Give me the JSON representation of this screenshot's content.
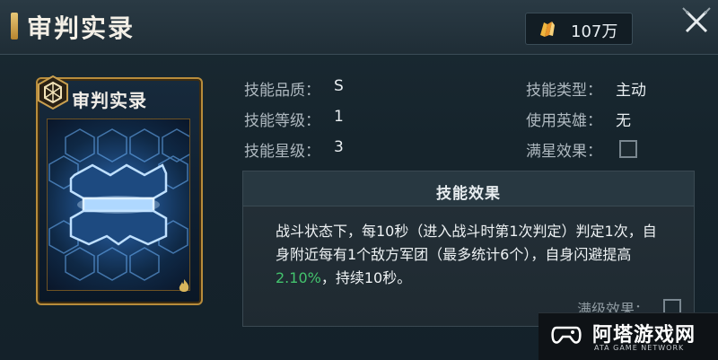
{
  "header": {
    "title": "审判实录",
    "currency_icon": "gold-crystal-icon",
    "currency_amount": "107万",
    "close_icon": "close-icon"
  },
  "card": {
    "title": "审判实录",
    "frame_color": "#b88c3b"
  },
  "attributes": {
    "quality_label": "技能品质：",
    "quality_value": "S",
    "level_label": "技能等级：",
    "level_value": "1",
    "star_label": "技能星级：",
    "star_value": "3",
    "type_label": "技能类型：",
    "type_value": "主动",
    "hero_label": "使用英雄：",
    "hero_value": "无",
    "full_star_label": "满星效果："
  },
  "effect": {
    "title": "技能效果",
    "desc_part1": "战斗状态下，每10秒（进入战斗时第1次判定）判定1次，自身附近每有1个敌方军团（最多统计6个），自身闪避提高",
    "desc_highlight": "2.10%",
    "desc_part2": "，持续10秒。",
    "highlight_color": "#43c36d",
    "max_level_label": "满级效果："
  },
  "watermark": {
    "name": "阿塔游戏网",
    "sub": "ATA GAME NETWORK"
  }
}
